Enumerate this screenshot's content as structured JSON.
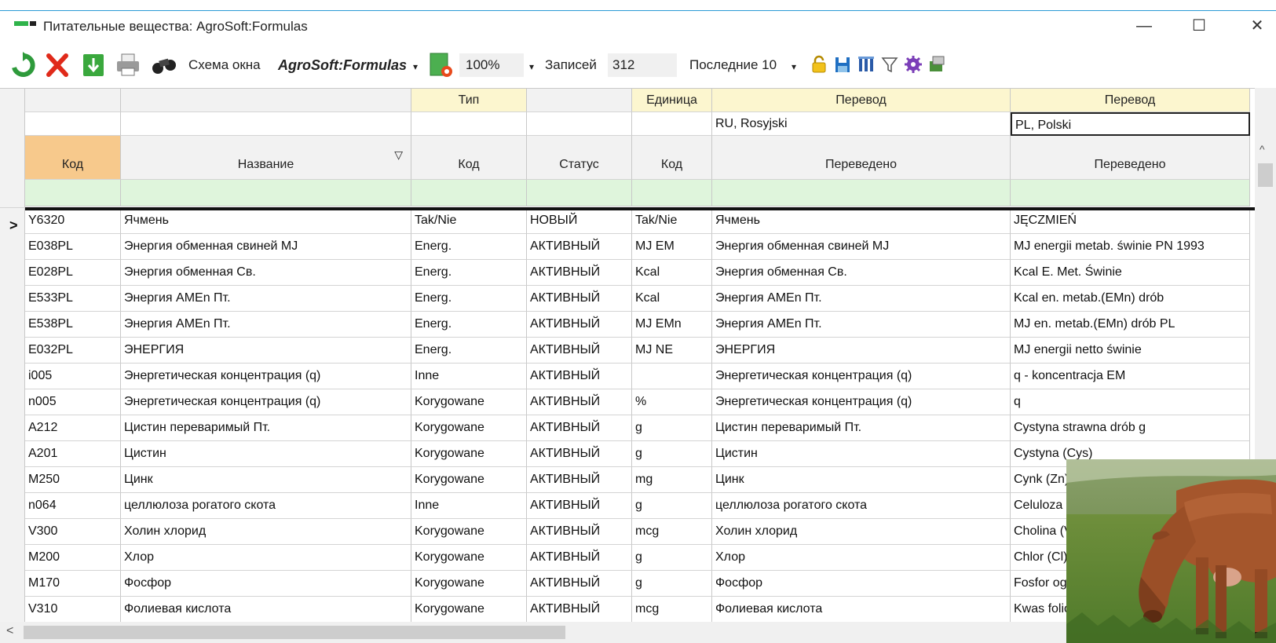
{
  "window": {
    "title": "Питательные вещества: AgroSoft:Formulas",
    "minimize": "—",
    "maximize": "☐",
    "close": "✕"
  },
  "toolbar": {
    "layout_label": "Схема окна",
    "layout_value": "AgroSoft:Formulas",
    "layout_arrow": "▾",
    "zoom_value": "100%",
    "zoom_arrow": "▾",
    "records_label": "Записей",
    "records_value": "312",
    "recent_label": "Последние 10",
    "recent_arrow": "▾"
  },
  "grid": {
    "group_headers": {
      "type": "Тип",
      "unit": "Единица",
      "translation_ru": "Перевод",
      "translation_pl": "Перевод"
    },
    "language_row": {
      "ru": "RU, Rosyjski",
      "pl": "PL, Polski"
    },
    "columns": {
      "code": "Код",
      "name": "Название",
      "type_code": "Код",
      "status": "Статус",
      "unit_code": "Код",
      "translated_ru": "Переведено",
      "translated_pl": "Переведено"
    },
    "sort_indicator": "▽",
    "current_row_marker": ">",
    "rows": [
      {
        "code": "Y6320",
        "name": "Ячмень",
        "type": "Tak/Nie",
        "status": "НОВЫЙ",
        "unit": "Tak/Nie",
        "ru": "Ячмень",
        "pl": "JĘCZMIEŃ"
      },
      {
        "code": "E038PL",
        "name": "Энергия обменная свиней MJ",
        "type": "Energ.",
        "status": "АКТИВНЫЙ",
        "unit": "MJ EM",
        "ru": "Энергия обменная свиней MJ",
        "pl": "MJ energii metab. świnie PN 1993"
      },
      {
        "code": "E028PL",
        "name": "Энергия обменная Св.",
        "type": "Energ.",
        "status": "АКТИВНЫЙ",
        "unit": "Kcal",
        "ru": "Энергия обменная Св.",
        "pl": "Kcal E. Met. Świnie"
      },
      {
        "code": "E533PL",
        "name": "Энергия AMEn Пт.",
        "type": "Energ.",
        "status": "АКТИВНЫЙ",
        "unit": "Kcal",
        "ru": "Энергия AMEn Пт.",
        "pl": "Kcal en. metab.(EMn) drób"
      },
      {
        "code": "E538PL",
        "name": "Энергия AMEn Пт.",
        "type": "Energ.",
        "status": "АКТИВНЫЙ",
        "unit": "MJ EMn",
        "ru": "Энергия AMEn Пт.",
        "pl": "MJ en. metab.(EMn) drób PL"
      },
      {
        "code": "E032PL",
        "name": "ЭНЕРГИЯ",
        "type": "Energ.",
        "status": "АКТИВНЫЙ",
        "unit": "MJ NE",
        "ru": "ЭНЕРГИЯ",
        "pl": "MJ energii netto świnie"
      },
      {
        "code": "i005",
        "name": "Энергетическая концентрация (q)",
        "type": "Inne",
        "status": "АКТИВНЫЙ",
        "unit": "",
        "ru": "Энергетическая концентрация (q)",
        "pl": "q - koncentracja EM"
      },
      {
        "code": "n005",
        "name": "Энергетическая концентрация (q)",
        "type": "Korygowane",
        "status": "АКТИВНЫЙ",
        "unit": "%",
        "ru": "Энергетическая концентрация (q)",
        "pl": "q"
      },
      {
        "code": "A212",
        "name": "Цистин переваримый Пт.",
        "type": "Korygowane",
        "status": "АКТИВНЫЙ",
        "unit": "g",
        "ru": "Цистин переваримый Пт.",
        "pl": "Cystyna strawna drób   g"
      },
      {
        "code": "A201",
        "name": "Цистин",
        "type": "Korygowane",
        "status": "АКТИВНЫЙ",
        "unit": "g",
        "ru": "Цистин",
        "pl": "Cystyna (Cys)"
      },
      {
        "code": "M250",
        "name": "Цинк",
        "type": "Korygowane",
        "status": "АКТИВНЫЙ",
        "unit": "mg",
        "ru": "Цинк",
        "pl": "Cynk (Zn)"
      },
      {
        "code": "n064",
        "name": "целлюлоза рогатого скота",
        "type": "Inne",
        "status": "АКТИВНЫЙ",
        "unit": "g",
        "ru": "целлюлоза рогатого скота",
        "pl": "Celuloza"
      },
      {
        "code": "V300",
        "name": "Холин хлорид",
        "type": "Korygowane",
        "status": "АКТИВНЫЙ",
        "unit": "mcg",
        "ru": "Холин хлорид",
        "pl": "Cholina (V"
      },
      {
        "code": "M200",
        "name": "Хлор",
        "type": "Korygowane",
        "status": "АКТИВНЫЙ",
        "unit": "g",
        "ru": "Хлор",
        "pl": "Chlor (Cl)"
      },
      {
        "code": "M170",
        "name": "Фосфор",
        "type": "Korygowane",
        "status": "АКТИВНЫЙ",
        "unit": "g",
        "ru": "Фосфор",
        "pl": "Fosfor og"
      },
      {
        "code": "V310",
        "name": "Фолиевая кислота",
        "type": "Korygowane",
        "status": "АКТИВНЫЙ",
        "unit": "mcg",
        "ru": "Фолиевая кислота",
        "pl": "Kwas folio"
      }
    ]
  },
  "scroll": {
    "up_arrow": "^",
    "left_arrow": "<"
  },
  "colors": {
    "header_yellow": "#fcf6cf",
    "header_orange": "#f7c98c",
    "filter_green": "#dff5dc",
    "grid_line": "#c8c8c8"
  },
  "icons": [
    "refresh-icon",
    "delete-icon",
    "download-icon",
    "print-icon",
    "binoculars-icon",
    "layout-settings-icon",
    "lock-icon",
    "save-icon",
    "columns-icon",
    "filter-icon",
    "gear-icon",
    "export-icon"
  ]
}
